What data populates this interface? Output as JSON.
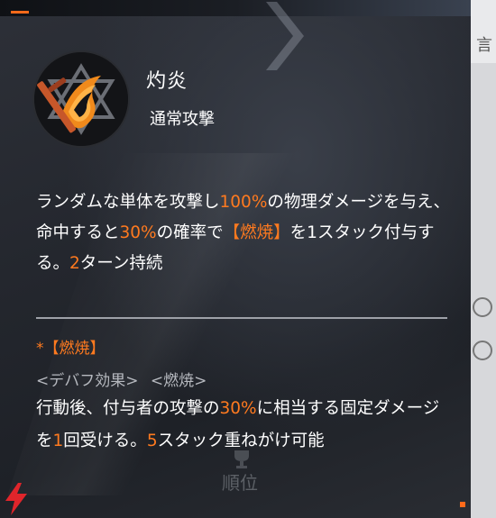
{
  "skill": {
    "name": "灼炎",
    "type": "通常攻撃",
    "icon": "flame-sword-emblem-icon",
    "description": {
      "seg1": "ランダムな単体を攻撃し",
      "seg2": "100%",
      "seg3": "の物理ダメージを与え、命中すると",
      "seg4": "30%",
      "seg5": "の確率で",
      "seg6": "【燃焼】",
      "seg7": "を1スタック付与する。",
      "seg8": "2",
      "seg9": "ターン持続"
    }
  },
  "status_effect": {
    "title": "*【燃焼】",
    "tag_debuff": "<デバフ効果>",
    "tag_name": "<燃焼>",
    "desc": {
      "seg1": "行動後、付与者の攻撃の",
      "seg2": "30%",
      "seg3": "に相当する固定ダメージを",
      "seg4": "1",
      "seg5": "回受ける。",
      "seg6": "5",
      "seg7": "スタック重ねがけ可能"
    }
  },
  "background": {
    "bottom_label": "順位",
    "right_glyph": "言",
    "watermark_logo": "lightning-logo-icon"
  },
  "colors": {
    "accent": "#ff7a1f",
    "panel_bg": "#1c1f26",
    "text": "#ffffff",
    "tag_text": "#b6b9bf"
  }
}
